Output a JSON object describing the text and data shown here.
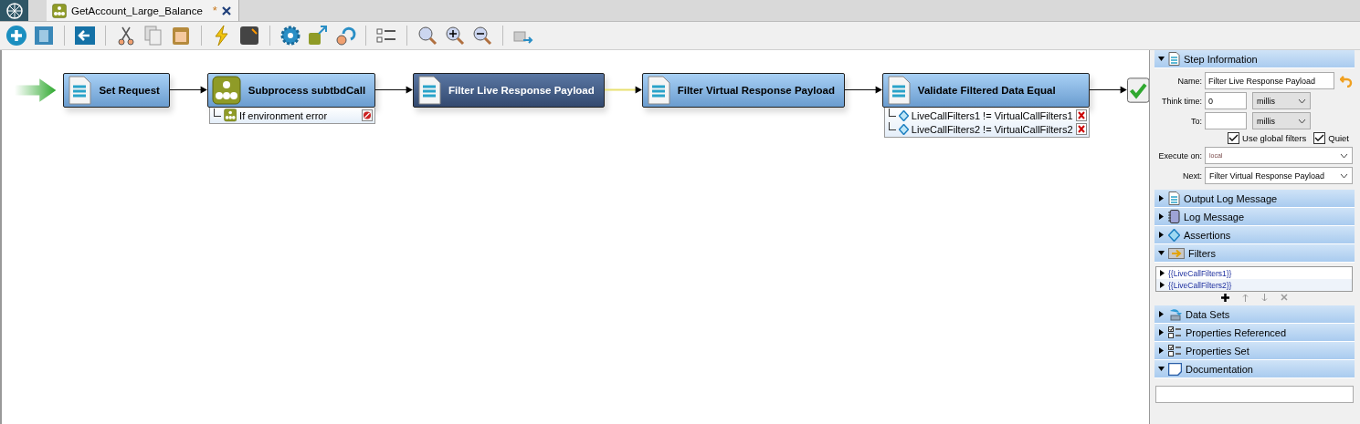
{
  "tab": {
    "title": "GetAccount_Large_Balance",
    "modified_mark": "*",
    "selected": true
  },
  "steps": [
    {
      "kind": "document",
      "label": "Set Request",
      "selected": false
    },
    {
      "kind": "subprocess",
      "label": "Subprocess subtbdCall",
      "selected": false,
      "attachments": [
        {
          "kind": "error_handler",
          "text": "If environment error"
        }
      ]
    },
    {
      "kind": "document",
      "label": "Filter Live Response Payload",
      "selected": true
    },
    {
      "kind": "document",
      "label": "Filter Virtual Response Payload",
      "selected": false
    },
    {
      "kind": "document",
      "label": "Validate Filtered Data Equal",
      "selected": false,
      "attachments": [
        {
          "kind": "assertion",
          "text": "LiveCallFilters1 != VirtualCallFilters1"
        },
        {
          "kind": "assertion",
          "text": "LiveCallFilters2 != VirtualCallFilters2"
        }
      ]
    }
  ],
  "panel": {
    "step_information": {
      "title": "Step Information",
      "expanded": true,
      "name_label": "Name:",
      "name": "Filter Live Response Payload",
      "think_time_label": "Think time:",
      "think_time": "0",
      "think_unit": "millis",
      "to_label": "To:",
      "to_unit": "millis",
      "use_global_filters": {
        "label": "Use global filters",
        "checked": true
      },
      "quiet": {
        "label": "Quiet",
        "checked": true
      },
      "execute_on_label": "Execute on:",
      "execute_on": "local",
      "next_label": "Next:",
      "next": "Filter Virtual Response Payload"
    },
    "sections": [
      {
        "kind": "output_log",
        "title": "Output Log Message",
        "expanded": false
      },
      {
        "kind": "log",
        "title": "Log Message",
        "expanded": false
      },
      {
        "kind": "assertions",
        "title": "Assertions",
        "expanded": false
      },
      {
        "kind": "filters",
        "title": "Filters",
        "expanded": true,
        "items": [
          "{{LiveCallFilters1}}",
          "{{LiveCallFilters2}}"
        ]
      },
      {
        "kind": "data_sets",
        "title": "Data Sets",
        "expanded": false
      },
      {
        "kind": "properties",
        "title": "Properties Referenced",
        "expanded": false
      },
      {
        "kind": "properties",
        "title": "Properties Set",
        "expanded": false
      },
      {
        "kind": "documentation",
        "title": "Documentation",
        "expanded": true
      }
    ]
  }
}
